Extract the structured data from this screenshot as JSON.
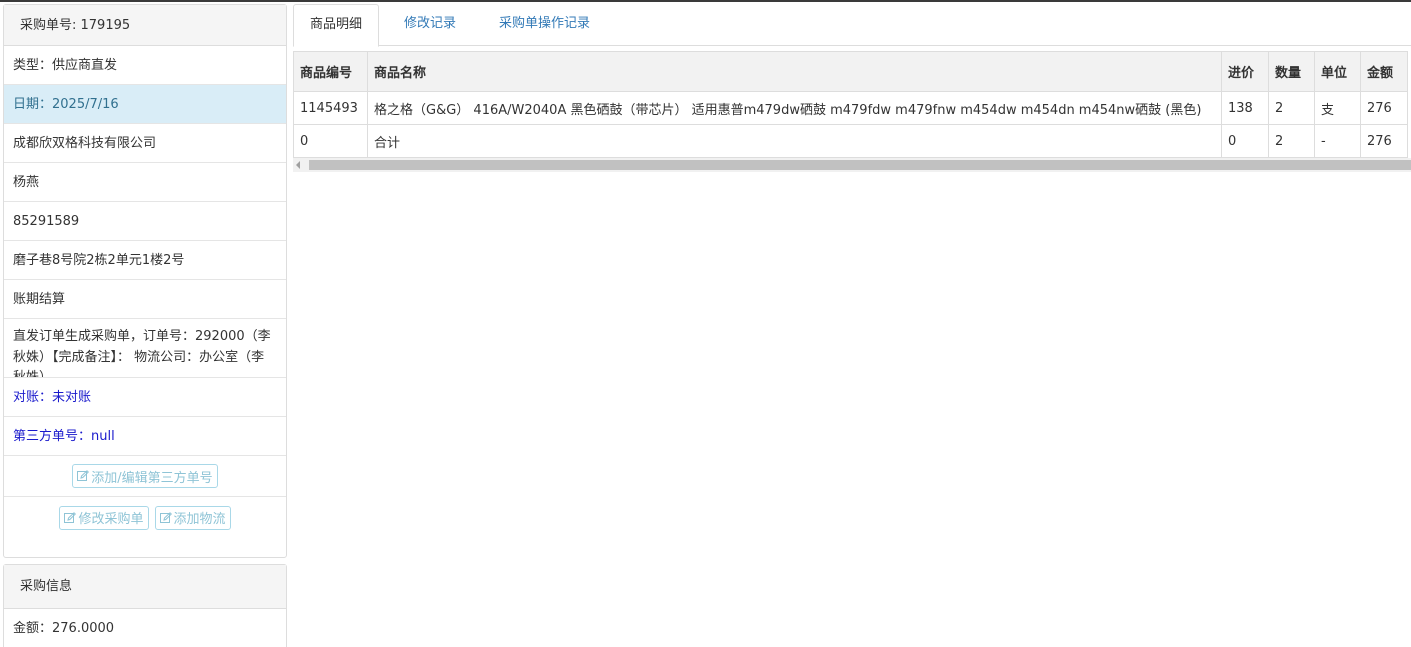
{
  "left": {
    "order_no_label": "采购单号: 179195",
    "rows": {
      "type": "类型：供应商直发",
      "date": "日期：2025/7/16",
      "supplier": "成都欣双格科技有限公司",
      "contact": "杨燕",
      "phone": "85291589",
      "address": "磨子巷8号院2栋2单元1楼2号",
      "settlement": "账期结算",
      "remark": "直发订单生成采购单，订单号：292000（李秋姝）【完成备注】： 物流公司：办公室（李秋姝）",
      "reconcile": "对账：未对账",
      "third_party": "第三方单号：null"
    },
    "buttons": {
      "add_third_party": "添加/编辑第三方单号",
      "edit_order": "修改采购单",
      "add_logistics": "添加物流"
    },
    "purchase_info": {
      "heading": "采购信息",
      "amount": "金额：276.0000"
    }
  },
  "tabs": [
    "商品明细",
    "修改记录",
    "采购单操作记录"
  ],
  "table": {
    "headers": [
      "商品编号",
      "商品名称",
      "进价",
      "数量",
      "单位",
      "金额"
    ],
    "rows": [
      [
        "1145493",
        "格之格（G&G） 416A/W2040A 黑色硒鼓（带芯片） 适用惠普m479dw硒鼓 m479fdw m479fnw m454dw m454dn m454nw硒鼓 (黑色)",
        "138",
        "2",
        "支",
        "276"
      ],
      [
        "0",
        "合计",
        "0",
        "2",
        "-",
        "276"
      ]
    ]
  },
  "colors": {
    "active_row_bg": "#d9edf7",
    "link_blue": "#337ab7",
    "reconcile_blue": "#1a1acc",
    "ghost_button": "#8fc4d6"
  },
  "icons": {
    "button_icon": "edit-icon"
  }
}
